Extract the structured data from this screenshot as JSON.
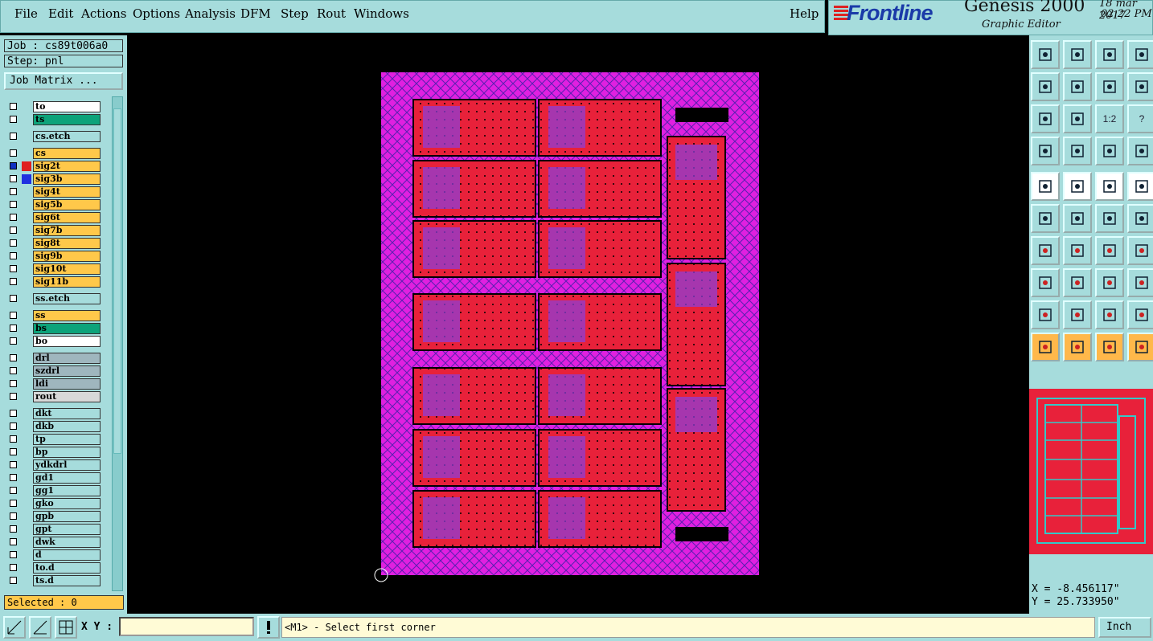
{
  "menu": {
    "items": [
      {
        "label": "File"
      },
      {
        "label": "Edit"
      },
      {
        "label": "Actions"
      },
      {
        "label": "Options"
      },
      {
        "label": "Analysis"
      },
      {
        "label": "DFM"
      },
      {
        "label": "Step"
      },
      {
        "label": "Rout"
      },
      {
        "label": "Windows"
      }
    ],
    "help": "Help"
  },
  "brand": {
    "logo": "Frontline",
    "product": "Genesis 2000",
    "subtitle": "Graphic Editor",
    "date": "18 mar 2017",
    "time": "02:22 PM"
  },
  "job": {
    "label": "Job : cs89t006a0",
    "step": "Step: pnl",
    "matrix_button": "Job Matrix ..."
  },
  "layers": [
    {
      "name": "to",
      "color": "#ffffff"
    },
    {
      "name": "ts",
      "color": "#0da37a"
    },
    {
      "name": "cs.etch",
      "color": "#a6dcdc"
    },
    {
      "name": "cs",
      "color": "#ffc84a"
    },
    {
      "name": "sig2t",
      "color": "#ffc84a",
      "active": true,
      "swatch": "#e02020"
    },
    {
      "name": "sig3b",
      "color": "#ffc84a",
      "swatch": "#2030e0"
    },
    {
      "name": "sig4t",
      "color": "#ffc84a"
    },
    {
      "name": "sig5b",
      "color": "#ffc84a"
    },
    {
      "name": "sig6t",
      "color": "#ffc84a"
    },
    {
      "name": "sig7b",
      "color": "#ffc84a"
    },
    {
      "name": "sig8t",
      "color": "#ffc84a"
    },
    {
      "name": "sig9b",
      "color": "#ffc84a"
    },
    {
      "name": "sig10t",
      "color": "#ffc84a"
    },
    {
      "name": "sig11b",
      "color": "#ffc84a"
    },
    {
      "name": "ss.etch",
      "color": "#a6dcdc"
    },
    {
      "name": "ss",
      "color": "#ffc84a"
    },
    {
      "name": "bs",
      "color": "#0da37a"
    },
    {
      "name": "bo",
      "color": "#ffffff"
    },
    {
      "name": "drl",
      "color": "#9fb6be"
    },
    {
      "name": "szdrl",
      "color": "#9fb6be"
    },
    {
      "name": "ldi",
      "color": "#9fb6be"
    },
    {
      "name": "rout",
      "color": "#d8d8d8"
    },
    {
      "name": "dkt",
      "color": "#a6dcdc"
    },
    {
      "name": "dkb",
      "color": "#a6dcdc"
    },
    {
      "name": "tp",
      "color": "#a6dcdc"
    },
    {
      "name": "bp",
      "color": "#a6dcdc"
    },
    {
      "name": "ydkdrl",
      "color": "#a6dcdc"
    },
    {
      "name": "gd1",
      "color": "#a6dcdc"
    },
    {
      "name": "gg1",
      "color": "#a6dcdc"
    },
    {
      "name": "gko",
      "color": "#a6dcdc"
    },
    {
      "name": "gpb",
      "color": "#a6dcdc"
    },
    {
      "name": "gpt",
      "color": "#a6dcdc"
    },
    {
      "name": "dwk",
      "color": "#a6dcdc"
    },
    {
      "name": "d",
      "color": "#a6dcdc"
    },
    {
      "name": "to.d",
      "color": "#a6dcdc"
    },
    {
      "name": "ts.d",
      "color": "#a6dcdc"
    }
  ],
  "selected": "Selected : 0",
  "bottom": {
    "xy_label": "X Y :",
    "xy_value": "",
    "prompt": "<M1> - Select first corner",
    "units": "Inch"
  },
  "coords": {
    "x": "X = -8.456117\"",
    "y": "Y = 25.733950\""
  },
  "tools": {
    "ratio": "1:2",
    "help": "?"
  },
  "colors": {
    "panel": "#a6dcdc",
    "board": "#e8213a",
    "border": "#e020e0"
  }
}
